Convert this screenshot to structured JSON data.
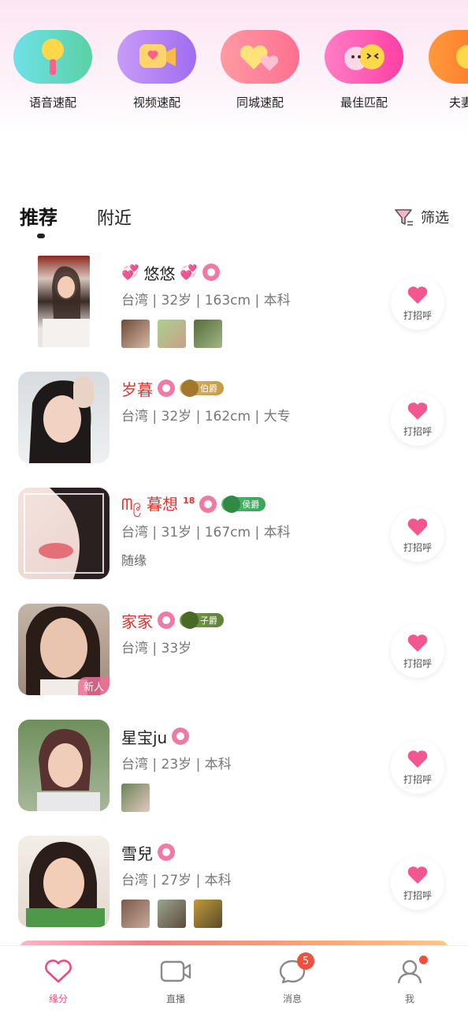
{
  "quick_match": [
    {
      "label": "语音速配",
      "icon": "microphone-icon",
      "color": "#5fd4e0"
    },
    {
      "label": "视频速配",
      "icon": "video-camera-icon",
      "color": "#b98af5"
    },
    {
      "label": "同城速配",
      "icon": "hearts-icon",
      "color": "#ff8fa6"
    },
    {
      "label": "最佳匹配",
      "icon": "couple-faces-icon",
      "color": "#ff5fb7"
    },
    {
      "label": "夫妻",
      "icon": "face-icon",
      "color": "#ff7a30"
    }
  ],
  "tabs": {
    "recommend": "推荐",
    "nearby": "附近",
    "filter": "筛选"
  },
  "users": [
    {
      "name": "悠悠",
      "meta": "台湾 | 32岁 | 163cm | 本科",
      "vip": false,
      "hearts": true,
      "thumb_count": 3
    },
    {
      "name": "岁暮",
      "meta": "台湾 | 32岁 | 162cm | 大专",
      "vip": true,
      "badge": "伯爵",
      "thumb_count": 0
    },
    {
      "name": "ᗰ၉ 暮想",
      "sup": "18",
      "meta": "台湾 | 31岁 | 167cm | 本科",
      "extra": "随缘",
      "vip": true,
      "badge": "侯爵",
      "thumb_count": 0
    },
    {
      "name": "家家",
      "meta": "台湾 | 33岁",
      "vip": true,
      "badge": "子爵",
      "new_tag": "新人",
      "thumb_count": 0
    },
    {
      "name": "星宝ju",
      "meta": "台湾 | 23岁 | 本科",
      "vip": false,
      "thumb_count": 1
    },
    {
      "name": "雪兒",
      "meta": "台湾 | 27岁 | 本科",
      "vip": false,
      "thumb_count": 3
    }
  ],
  "greet_label": "打招呼",
  "nav": {
    "items": [
      {
        "label": "缘分",
        "icon": "heart-icon",
        "active": true
      },
      {
        "label": "直播",
        "icon": "video-camera-icon"
      },
      {
        "label": "消息",
        "icon": "chat-bubble-icon",
        "badge": "5"
      },
      {
        "label": "我",
        "icon": "user-icon"
      }
    ]
  },
  "colors": {
    "accent": "#f0497c",
    "vip_name": "#e0342f",
    "badge_red": "#f0503d"
  }
}
